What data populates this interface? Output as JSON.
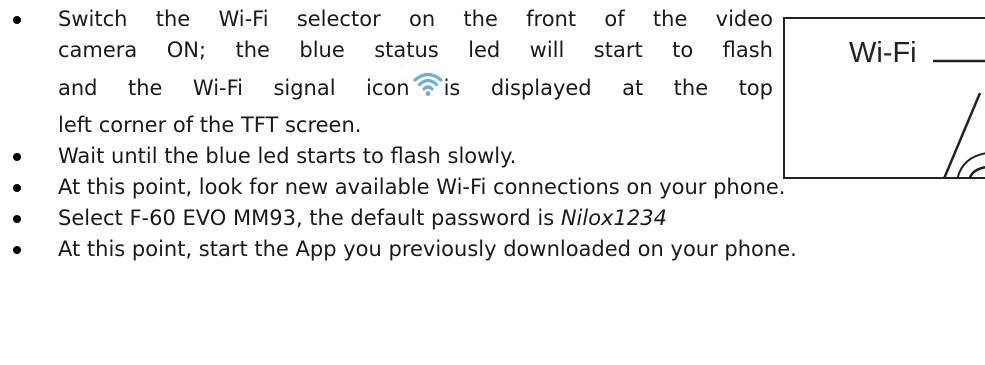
{
  "instructions": {
    "item1": {
      "line1": "Switch the Wi-Fi selector on the front of the video",
      "line2": "camera ON; the blue status led will start to flash",
      "line3_before_icon": "and the Wi-Fi signal icon",
      "line3_after_icon": "is displayed at the top",
      "line4": "left corner of the TFT screen."
    },
    "item2": "Wait until the blue led starts to flash slowly.",
    "item3": "At this point, look for new available Wi-Fi connections on your phone.",
    "item4": {
      "text": "Select F-60 EVO MM93, the default password is ",
      "password": "Nilox1234"
    },
    "item5": "At this point, start the App you previously downloaded on your phone."
  },
  "figure": {
    "label": "Wi-Fi"
  },
  "icons": {
    "inline_icon": "wifi-signal-icon",
    "inline_icon_color": "#5aa0d6"
  }
}
